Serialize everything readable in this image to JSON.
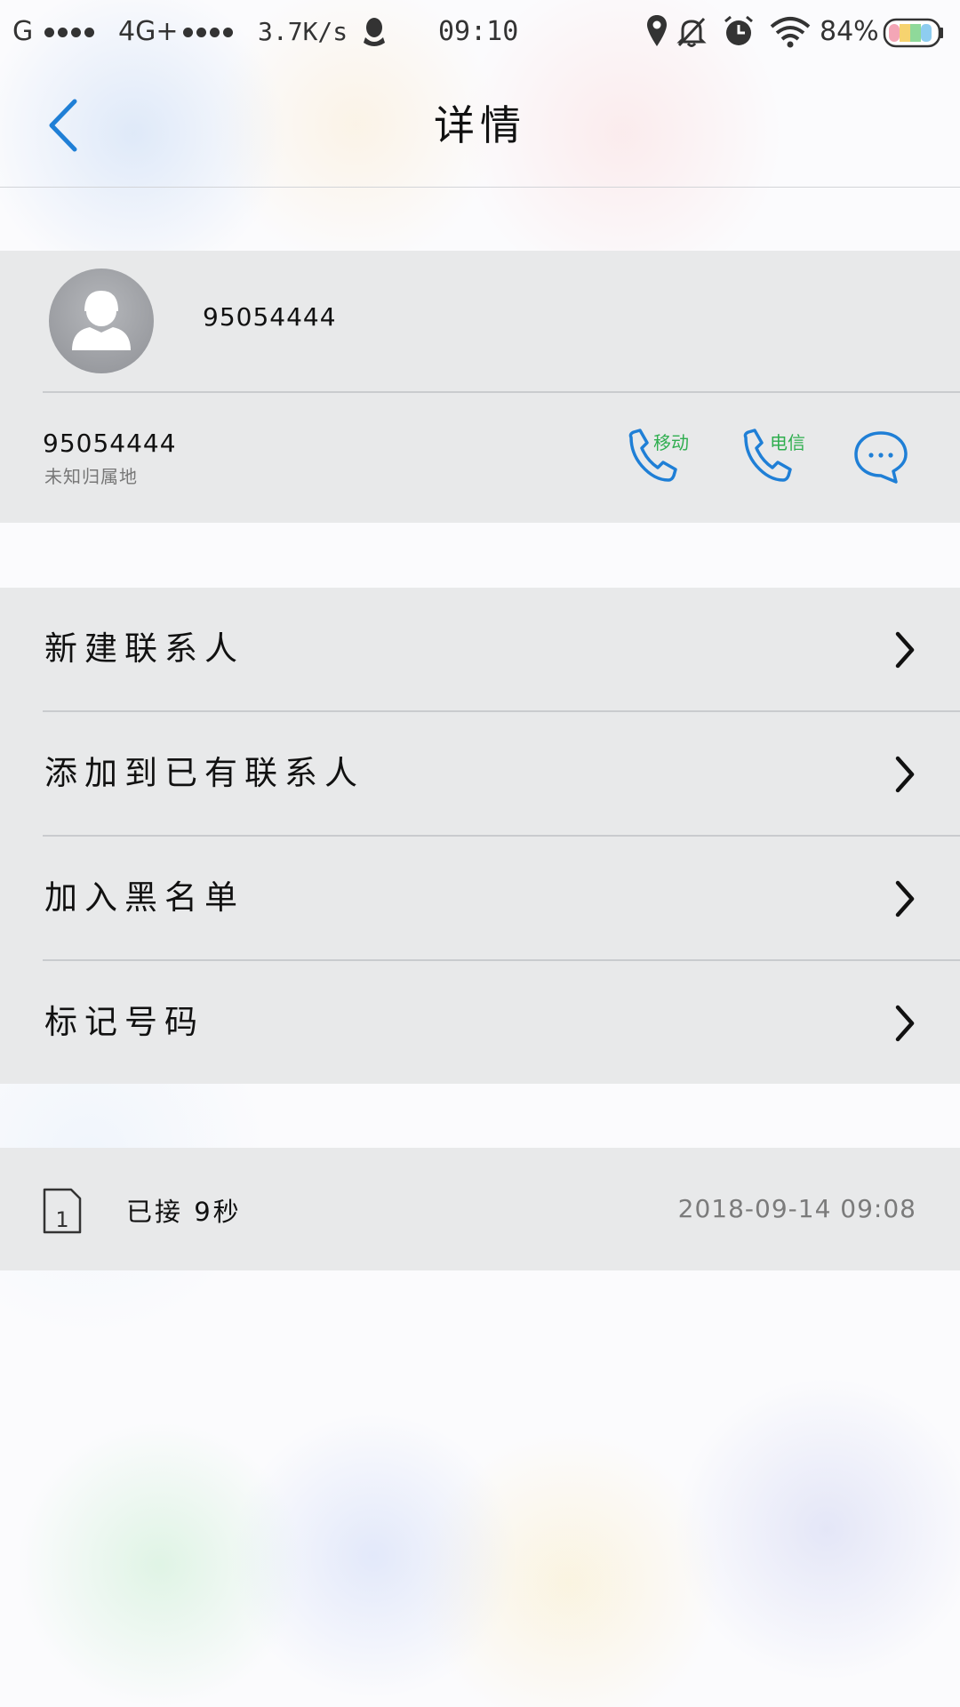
{
  "status_bar": {
    "carrier1": "G",
    "carrier2": "4G+",
    "speed": "3.7K/s",
    "time": "09:10",
    "battery": "84%",
    "icons": [
      "signal-dots-icon",
      "qq-icon",
      "location-icon",
      "bell-off-icon",
      "alarm-icon",
      "wifi-icon",
      "battery-icon"
    ]
  },
  "header": {
    "title": "详情",
    "back_icon": "chevron-left-icon"
  },
  "contact": {
    "name": "95054444",
    "number": "95054444",
    "location": "未知归属地",
    "call_buttons": [
      {
        "label": "移动",
        "icon": "phone-icon"
      },
      {
        "label": "电信",
        "icon": "phone-icon"
      }
    ],
    "message_icon": "message-bubble-icon"
  },
  "menu": {
    "items": [
      {
        "label": "新建联系人"
      },
      {
        "label": "添加到已有联系人"
      },
      {
        "label": "加入黑名单"
      },
      {
        "label": "标记号码"
      }
    ]
  },
  "call_log": {
    "sim_slot": "1",
    "status": "已接 9秒",
    "time": "2018-09-14 09:08"
  },
  "colors": {
    "accent_blue": "#1f7fd6",
    "label_green": "#2fae4f",
    "panel_gray": "#e8e9ea"
  }
}
